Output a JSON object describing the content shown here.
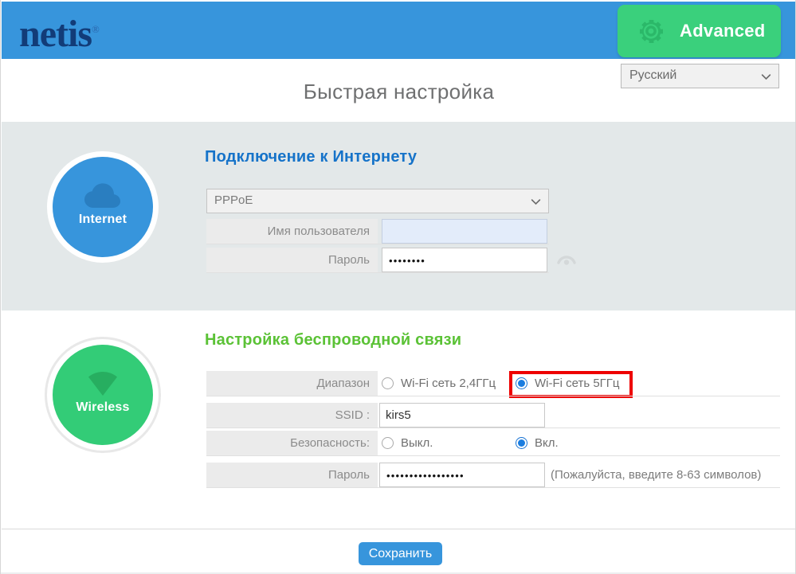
{
  "header": {
    "logo": "netis",
    "logo_trademark": "®",
    "advanced_button": "Advanced",
    "gear_icon": "gear-icon",
    "brand_blue": "#3795dc",
    "advanced_green": "#3ad07c"
  },
  "language": {
    "selected": "Русский",
    "chevron_icon": "chevron-down-icon"
  },
  "page_title": "Быстрая настройка",
  "internet": {
    "badge_label": "Internet",
    "badge_icon": "cloud-icon",
    "heading": "Подключение к Интернету",
    "protocol": {
      "selected": "PPPoE",
      "chevron_icon": "chevron-down-icon"
    },
    "username": {
      "label": "Имя пользователя",
      "value": "",
      "placeholder": ""
    },
    "password": {
      "label": "Пароль",
      "value": "••••••••",
      "reveal_icon": "eye-icon"
    }
  },
  "wireless": {
    "badge_label": "Wireless",
    "badge_icon": "wifi-icon",
    "heading": "Настройка беспроводной связи",
    "band": {
      "label": "Диапазон",
      "options": [
        {
          "label": "Wi-Fi сеть 2,4ГГц",
          "checked": false
        },
        {
          "label": "Wi-Fi сеть 5ГГц",
          "checked": true
        }
      ]
    },
    "ssid": {
      "label": "SSID :",
      "value": "kirs5"
    },
    "security": {
      "label": "Безопасность:",
      "options": [
        {
          "label": "Выкл.",
          "checked": false
        },
        {
          "label": "Вкл.",
          "checked": true
        }
      ]
    },
    "password": {
      "label": "Пароль",
      "value": "•••••••••••••••••",
      "hint": "(Пожалуйста, введите 8-63 символов)"
    }
  },
  "annotation": {
    "target": "Wi-Fi сеть 5ГГц",
    "color": "#ee0000"
  },
  "footer": {
    "save_button": "Сохранить"
  }
}
